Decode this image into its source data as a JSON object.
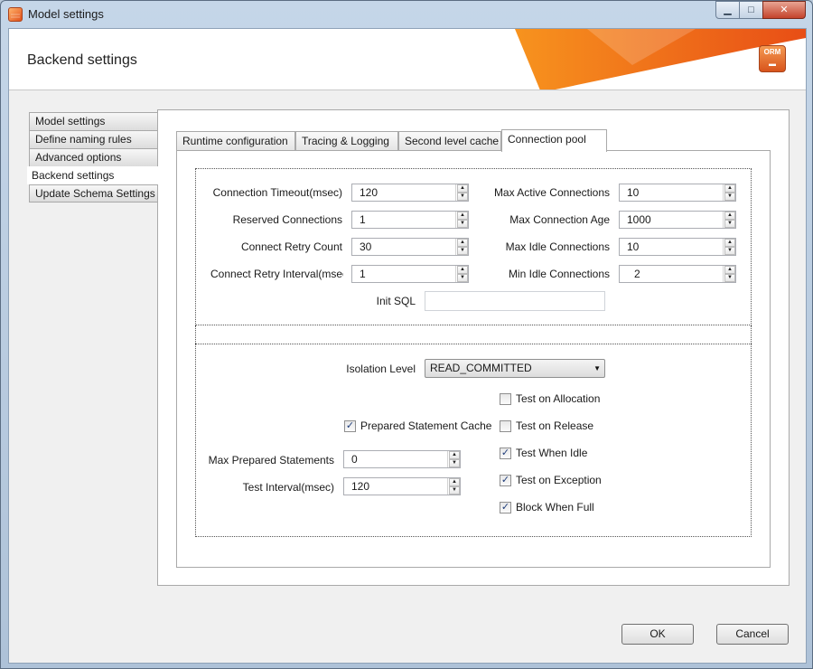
{
  "window": {
    "title": "Model settings",
    "controls": {
      "minimize": "▁",
      "maximize": "□",
      "close": "✕"
    }
  },
  "header": {
    "title": "Backend settings",
    "badge_icon": "orm-logo-icon"
  },
  "sidebar": {
    "items": [
      {
        "label": "Model settings"
      },
      {
        "label": "Define naming rules"
      },
      {
        "label": "Advanced options"
      },
      {
        "label": "Backend settings",
        "active": true
      },
      {
        "label": "Update Schema Settings"
      }
    ]
  },
  "tabs": [
    {
      "label": "Runtime configuration"
    },
    {
      "label": "Tracing & Logging"
    },
    {
      "label": "Second level cache"
    },
    {
      "label": "Connection pool",
      "active": true
    }
  ],
  "pool": {
    "connection_timeout": {
      "label": "Connection Timeout(msec)",
      "value": "120"
    },
    "reserved_connections": {
      "label": "Reserved Connections",
      "value": "1"
    },
    "connect_retry_count": {
      "label": "Connect Retry Count",
      "value": "30"
    },
    "connect_retry_interval": {
      "label": "Connect Retry Interval(msec",
      "value": "1"
    },
    "max_active_connections": {
      "label": "Max Active Connections",
      "value": "10"
    },
    "max_connection_age": {
      "label": "Max Connection Age",
      "value": "1000"
    },
    "max_idle_connections": {
      "label": "Max Idle Connections",
      "value": "10"
    },
    "min_idle_connections": {
      "label": "Min Idle Connections",
      "value": "2"
    },
    "init_sql": {
      "label": "Init SQL",
      "value": ""
    }
  },
  "validation": {
    "isolation_level": {
      "label": "Isolation Level",
      "value": "READ_COMMITTED"
    },
    "prepared_statement_cache": {
      "label": "Prepared Statement Cache",
      "checked": true
    },
    "max_prepared_statements": {
      "label": "Max Prepared Statements",
      "value": "0"
    },
    "test_interval": {
      "label": "Test Interval(msec)",
      "value": "120"
    },
    "test_on_allocation": {
      "label": "Test on Allocation",
      "checked": false
    },
    "test_on_release": {
      "label": "Test on Release",
      "checked": false
    },
    "test_when_idle": {
      "label": "Test When Idle",
      "checked": true
    },
    "test_on_exception": {
      "label": "Test on Exception",
      "checked": true
    },
    "block_when_full": {
      "label": "Block When Full",
      "checked": true
    }
  },
  "footer": {
    "ok_label": "OK",
    "cancel_label": "Cancel"
  },
  "colors": {
    "accent_orange": "#f26a1b",
    "window_frame": "#b9c9da",
    "panel_bg": "#f0f0f0"
  },
  "glyphs": {
    "spin_up": "▲",
    "spin_down": "▼",
    "check_mark": "✓",
    "dropdown": "▼"
  }
}
